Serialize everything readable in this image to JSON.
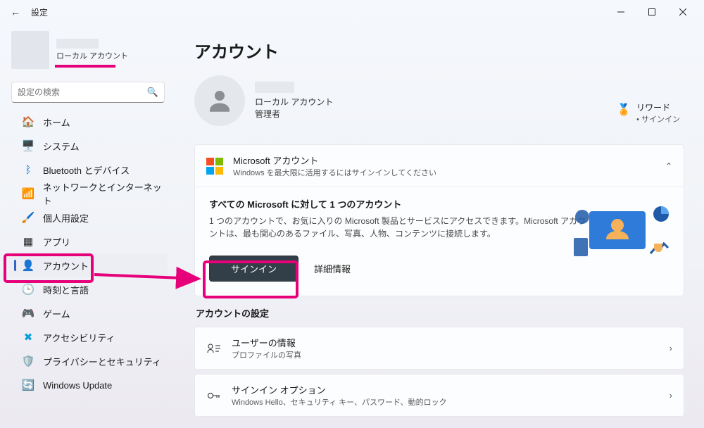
{
  "titlebar": {
    "title": "設定"
  },
  "sidebar": {
    "user": {
      "type_label": "ローカル アカウント"
    },
    "search": {
      "placeholder": "設定の検索"
    },
    "items": [
      {
        "icon": "🏠",
        "label": "ホーム"
      },
      {
        "icon": "🖥️",
        "label": "システム"
      },
      {
        "icon": "ᛒ",
        "label": "Bluetooth とデバイス",
        "icon_color": "#0078d4"
      },
      {
        "icon": "📶",
        "label": "ネットワークとインターネット"
      },
      {
        "icon": "🖌️",
        "label": "個人用設定"
      },
      {
        "icon": "▦",
        "label": "アプリ"
      },
      {
        "icon": "👤",
        "label": "アカウント",
        "active": true
      },
      {
        "icon": "🕒",
        "label": "時刻と言語"
      },
      {
        "icon": "🎮",
        "label": "ゲーム"
      },
      {
        "icon": "✖",
        "label": "アクセシビリティ",
        "icon_color": "#0aa0d6"
      },
      {
        "icon": "🛡️",
        "label": "プライバシーとセキュリティ"
      },
      {
        "icon": "🔄",
        "label": "Windows Update",
        "icon_color": "#0aa0d6"
      }
    ]
  },
  "page": {
    "title": "アカウント",
    "account": {
      "type": "ローカル アカウント",
      "role": "管理者"
    },
    "rewards": {
      "title": "リワード",
      "sub": "• サインイン"
    },
    "ms_card": {
      "head": "Microsoft アカウント",
      "sub": "Windows を最大限に活用するにはサインインしてください",
      "body_head": "すべての Microsoft に対して 1 つのアカウント",
      "body": "1 つのアカウントで、お気に入りの Microsoft 製品とサービスにアクセスできます。Microsoft アカウントは、最も関心のあるファイル、写真、人物、コンテンツに接続します。",
      "signin_btn": "サインイン",
      "details_link": "詳細情報"
    },
    "settings_section": "アカウントの設定",
    "rows": [
      {
        "title": "ユーザーの情報",
        "sub": "プロファイルの写真"
      },
      {
        "title": "サインイン オプション",
        "sub": "Windows Hello、セキュリティ キー、パスワード、動的ロック"
      }
    ]
  }
}
